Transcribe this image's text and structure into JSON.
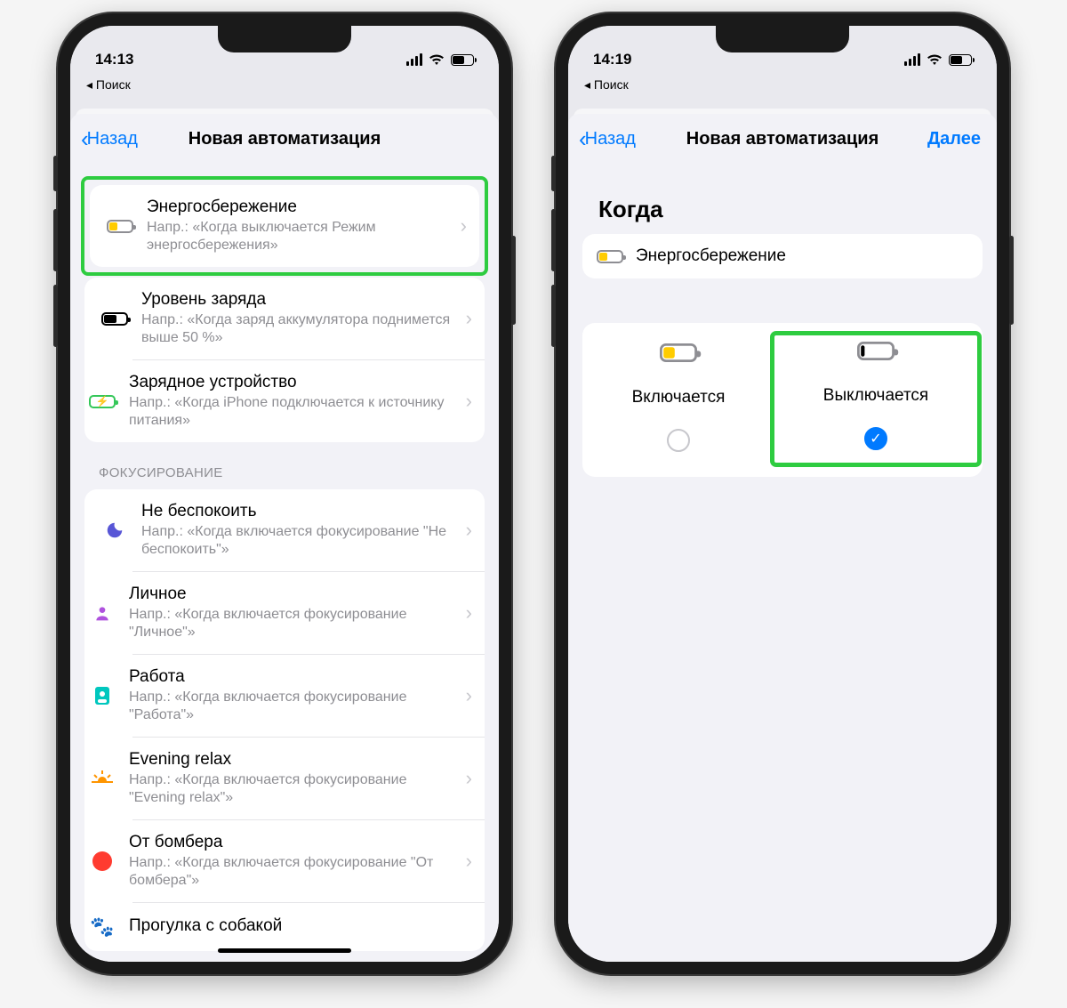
{
  "status": {
    "time_left": "14:13",
    "time_right": "14:19",
    "breadcrumb": "◂ Поиск"
  },
  "nav": {
    "back": "Назад",
    "title": "Новая автоматизация",
    "next": "Далее"
  },
  "left_screen": {
    "triggers": [
      {
        "title": "Энергосбережение",
        "sub": "Напр.: «Когда выключается Режим энергосбережения»"
      },
      {
        "title": "Уровень заряда",
        "sub": "Напр.: «Когда заряд аккумулятора поднимется выше 50 %»"
      },
      {
        "title": "Зарядное устройство",
        "sub": "Напр.: «Когда iPhone подключается к источнику питания»"
      }
    ],
    "focus_header": "ФОКУСИРОВАНИЕ",
    "focus": [
      {
        "title": "Не беспокоить",
        "sub": "Напр.: «Когда включается фокусирование \"Не беспокоить\"»"
      },
      {
        "title": "Личное",
        "sub": "Напр.: «Когда включается фокусирование \"Личное\"»"
      },
      {
        "title": "Работа",
        "sub": "Напр.: «Когда включается фокусирование \"Работа\"»"
      },
      {
        "title": "Evening relax",
        "sub": "Напр.: «Когда включается фокусирование \"Evening relax\"»"
      },
      {
        "title": "От бомбера",
        "sub": "Напр.: «Когда включается фокусирование \"От бомбера\"»"
      },
      {
        "title": "Прогулка с собакой",
        "sub": ""
      }
    ]
  },
  "right_screen": {
    "section": "Когда",
    "trigger": "Энергосбережение",
    "on_label": "Включается",
    "off_label": "Выключается"
  }
}
